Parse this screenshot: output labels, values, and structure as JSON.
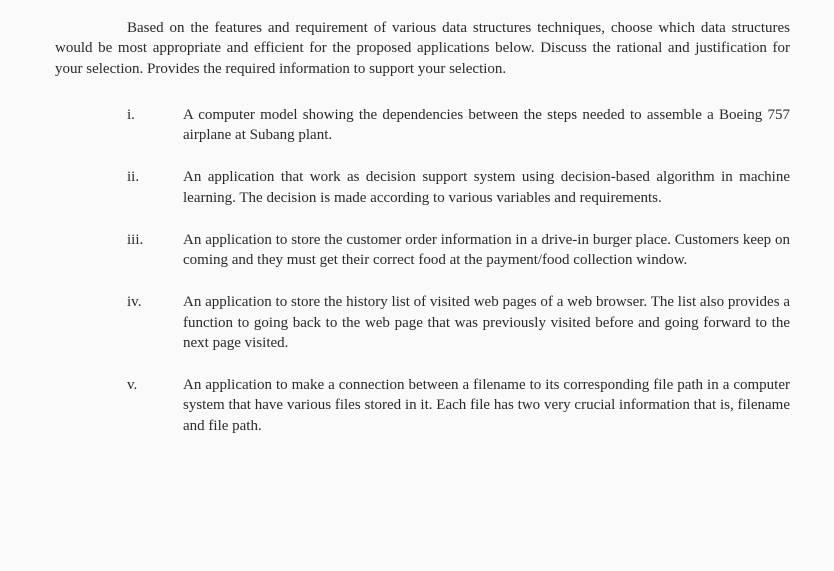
{
  "intro": "Based on the features and requirement of various data structures techniques, choose which data structures would be most appropriate and efficient for the proposed applications below. Discuss the rational and justification for your selection. Provides the required information to support your selection.",
  "items": [
    {
      "marker": "i.",
      "text": "A computer model showing the dependencies between the steps needed to assemble a Boeing 757 airplane at Subang plant."
    },
    {
      "marker": "ii.",
      "text": "An application that work as decision support system using decision-based algorithm in machine learning. The decision is made according to various variables and requirements."
    },
    {
      "marker": "iii.",
      "text": "An application to store the customer order information in a drive-in burger place. Customers keep on coming and they must get their correct food at the payment/food collection window."
    },
    {
      "marker": "iv.",
      "text": "An application to store the history list of visited web pages of a web browser. The list also provides a function to going back to the web page that was previously visited before and going forward to the next page visited."
    },
    {
      "marker": "v.",
      "text": "An application to make a connection between a filename to its corresponding file path in a computer system that have various files stored in it. Each file has two very crucial information that is, filename and file path."
    }
  ]
}
